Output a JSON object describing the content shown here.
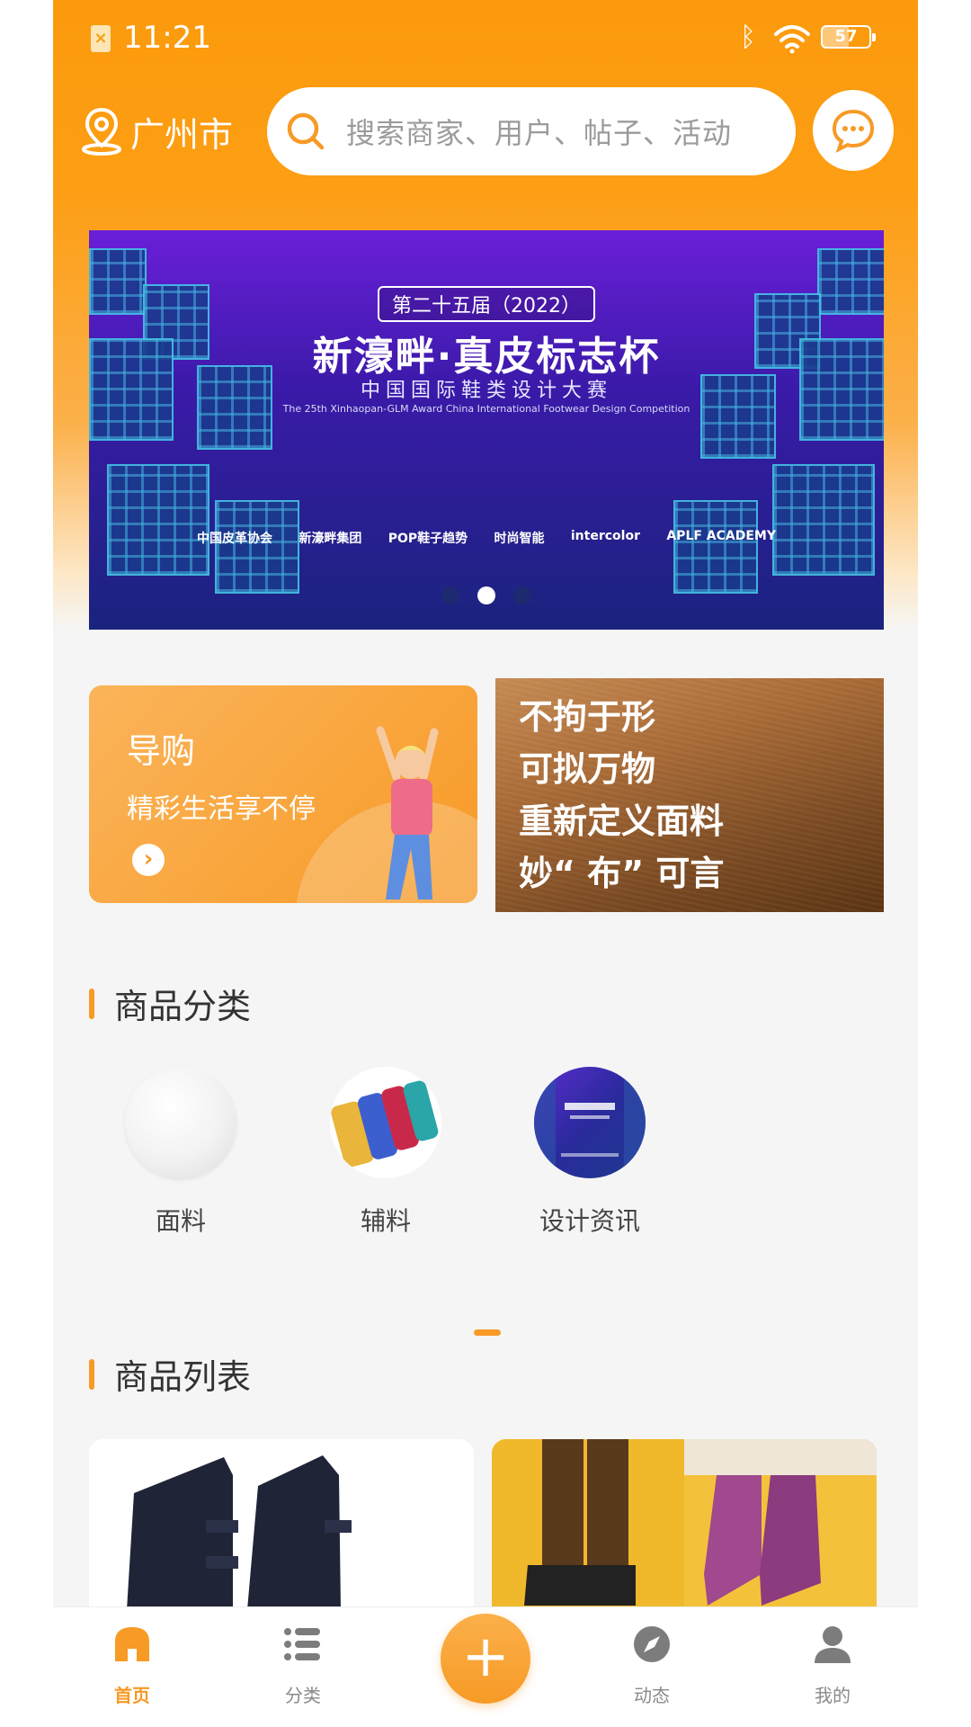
{
  "status_bar": {
    "time": "11:21",
    "battery": "57",
    "sim_icon": "sim-x-icon",
    "bluetooth_icon": "bluetooth-icon",
    "wifi_icon": "wifi-icon"
  },
  "header": {
    "city": "广州市",
    "search_placeholder": "搜索商家、用户、帖子、活动",
    "message_icon": "chat-icon"
  },
  "banner": {
    "tag": "第二十五届（2022）",
    "title": "新濠畔·真皮标志杯",
    "subtitle": "中国国际鞋类设计大赛",
    "english": "The 25th Xinhaopan-GLM Award China International Footwear Design Competition",
    "logos": [
      "中国皮革协会",
      "新濠畔集团",
      "POP鞋子趋势",
      "时尚智能",
      "intercolor",
      "APLF ACADEMY"
    ],
    "slide_count": 3,
    "active_slide": 2
  },
  "promo_guide": {
    "title": "导购",
    "subtitle": "精彩生活享不停"
  },
  "promo_fabric": {
    "lines": [
      "不拘于形",
      "可拟万物",
      "重新定义面料",
      "妙“ 布” 可言"
    ]
  },
  "sections": {
    "categories_title": "商品分类",
    "products_title": "商品列表"
  },
  "categories": [
    {
      "label": "面料"
    },
    {
      "label": "辅料"
    },
    {
      "label": "设计资讯"
    }
  ],
  "tab_bar": {
    "tabs": [
      {
        "label": "首页",
        "icon": "home-icon",
        "active": true
      },
      {
        "label": "分类",
        "icon": "list-icon",
        "active": false
      },
      {
        "label": "动态",
        "icon": "compass-icon",
        "active": false
      },
      {
        "label": "我的",
        "icon": "user-icon",
        "active": false
      }
    ],
    "add_label": "+"
  },
  "colors": {
    "accent": "#f79a26",
    "header_orange": "#fb9a0c",
    "tab_inactive": "#8a8a8a",
    "banner_purple": "#6a1fd8"
  }
}
